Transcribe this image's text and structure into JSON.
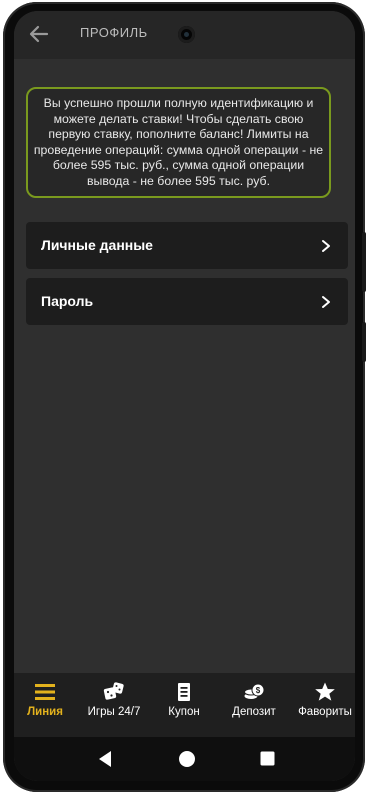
{
  "header": {
    "title": "ПРОФИЛЬ",
    "back_icon": "arrow-left-icon"
  },
  "notice": {
    "text": "Вы успешно прошли полную идентификацию и можете делать ставки! Чтобы сделать свою первую ставку, пополните баланс! Лимиты на проведение операций: сумма одной операции - не более 595 тыс. руб., сумма одной операции вывода - не более 595 тыс. руб.",
    "border_color": "#7a9a1e"
  },
  "menu": {
    "items": [
      {
        "label": "Личные данные",
        "icon": "chevron-right-icon"
      },
      {
        "label": "Пароль",
        "icon": "chevron-right-icon"
      }
    ]
  },
  "bottom_nav": {
    "accent": "#e3b21d",
    "items": [
      {
        "label": "Линия",
        "icon": "menu-lines-icon",
        "active": true
      },
      {
        "label": "Игры 24/7",
        "icon": "dice-icon",
        "active": false
      },
      {
        "label": "Купон",
        "icon": "coupon-icon",
        "active": false
      },
      {
        "label": "Депозит",
        "icon": "coins-icon",
        "active": false
      },
      {
        "label": "Фавориты",
        "icon": "star-icon",
        "active": false
      }
    ]
  },
  "system_bar": {
    "icons": [
      "back-triangle-icon",
      "home-circle-icon",
      "recents-square-icon"
    ]
  }
}
